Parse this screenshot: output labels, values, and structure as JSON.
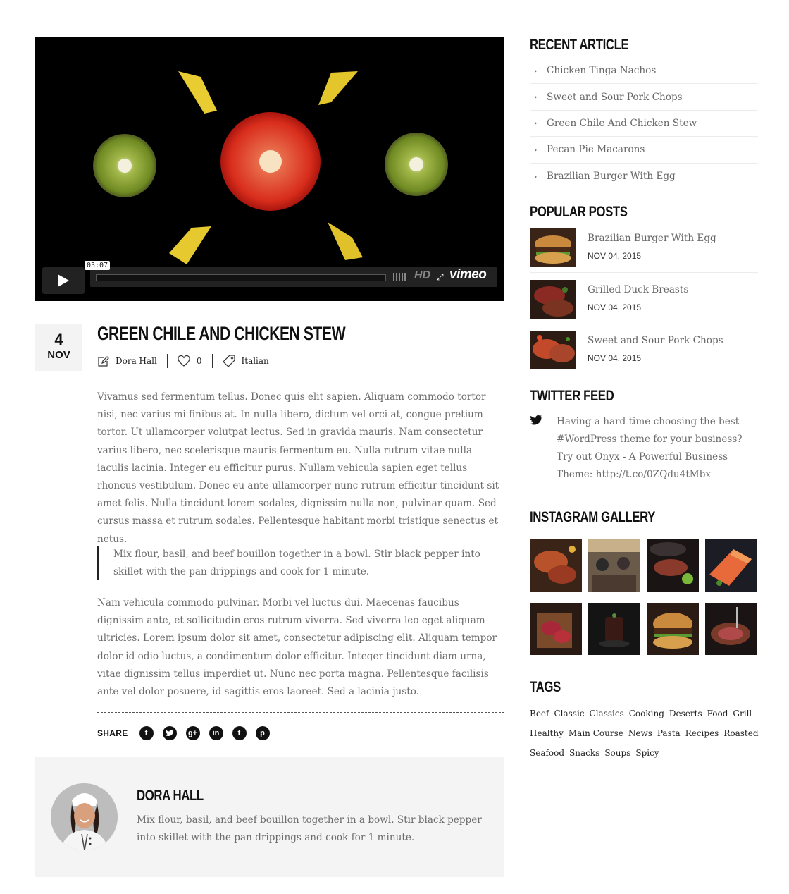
{
  "video": {
    "time": "03:07",
    "quality": "HD",
    "provider": "vimeo"
  },
  "post": {
    "day": "4",
    "month": "NOV",
    "title": "GREEN CHILE AND CHICKEN STEW",
    "author": "Dora Hall",
    "likes": "0",
    "category": "Italian",
    "paragraph1": "Vivamus sed fermentum tellus. Donec quis elit sapien. Aliquam commodo tortor nisi, nec varius mi finibus at. In nulla libero, dictum vel orci at, congue pretium tortor. Ut ullamcorper volutpat lectus. Sed in gravida mauris. Nam consectetur varius libero, nec scelerisque mauris fermentum eu. Nulla rutrum vitae nulla iaculis lacinia. Integer eu efficitur purus. Nullam vehicula sapien eget tellus rhoncus vestibulum. Donec eu ante ullamcorper nunc rutrum efficitur tincidunt sit amet felis. Nulla tincidunt lorem sodales, dignissim nulla non, pulvinar quam. Sed cursus massa et rutrum sodales. Pellentesque habitant morbi tristique senectus et netus.",
    "quote": "Mix flour, basil, and beef bouillon together in a bowl. Stir black pepper into skillet with the pan drippings and cook for 1 minute.",
    "paragraph2": "Nam vehicula commodo pulvinar. Morbi vel luctus dui. Maecenas faucibus dignissim ante, et sollicitudin eros rutrum viverra. Sed viverra leo eget aliquam ultricies. Lorem ipsum dolor sit amet, consectetur adipiscing elit. Aliquam tempor dolor id odio luctus, a condimentum dolor efficitur. Integer tincidunt diam urna, vitae dignissim tellus imperdiet ut. Nunc nec porta magna. Pellentesque facilisis ante vel dolor posuere, id sagittis eros laoreet. Sed a lacinia justo.",
    "share_label": "SHARE",
    "share_icons": [
      "facebook-icon",
      "twitter-icon",
      "google-plus-icon",
      "linkedin-icon",
      "tumblr-icon",
      "pinterest-icon"
    ]
  },
  "author_box": {
    "name": "DORA HALL",
    "bio": "Mix flour, basil, and beef bouillon together in a bowl. Stir black pepper into skillet with the pan drippings and cook for 1 minute."
  },
  "sidebar": {
    "recent_title": "RECENT ARTICLE",
    "recent": [
      "Chicken Tinga Nachos",
      "Sweet and Sour Pork Chops",
      "Green Chile And Chicken Stew",
      "Pecan Pie Macarons",
      "Brazilian Burger With Egg"
    ],
    "popular_title": "POPULAR POSTS",
    "popular": [
      {
        "title": "Brazilian Burger With Egg",
        "date": "NOV 04, 2015"
      },
      {
        "title": "Grilled Duck Breasts",
        "date": "NOV 04, 2015"
      },
      {
        "title": "Sweet and Sour Pork Chops",
        "date": "NOV 04, 2015"
      }
    ],
    "twitter_title": "TWITTER FEED",
    "tweet": "Having a hard time choosing the best #WordPress theme for your business? Try out Onyx - A Powerful Business Theme: http://t.co/0ZQdu4tMbx",
    "instagram_title": "INSTAGRAM GALLERY",
    "tags_title": "TAGS",
    "tags_rows": [
      [
        "Beef",
        "Classic",
        "Classics",
        "Cooking",
        "Deserts",
        "Food",
        "Grill"
      ],
      [
        "Healthy",
        "Main Course",
        "News",
        "Pasta",
        "Recipes",
        "Roasted"
      ],
      [
        "Seafood",
        "Snacks",
        "Soups",
        "Spicy"
      ]
    ]
  },
  "colors": {
    "heading": "#111111",
    "body_text": "#6b6b6b",
    "panel_bg": "#f4f4f4",
    "video_bg": "#000000"
  }
}
